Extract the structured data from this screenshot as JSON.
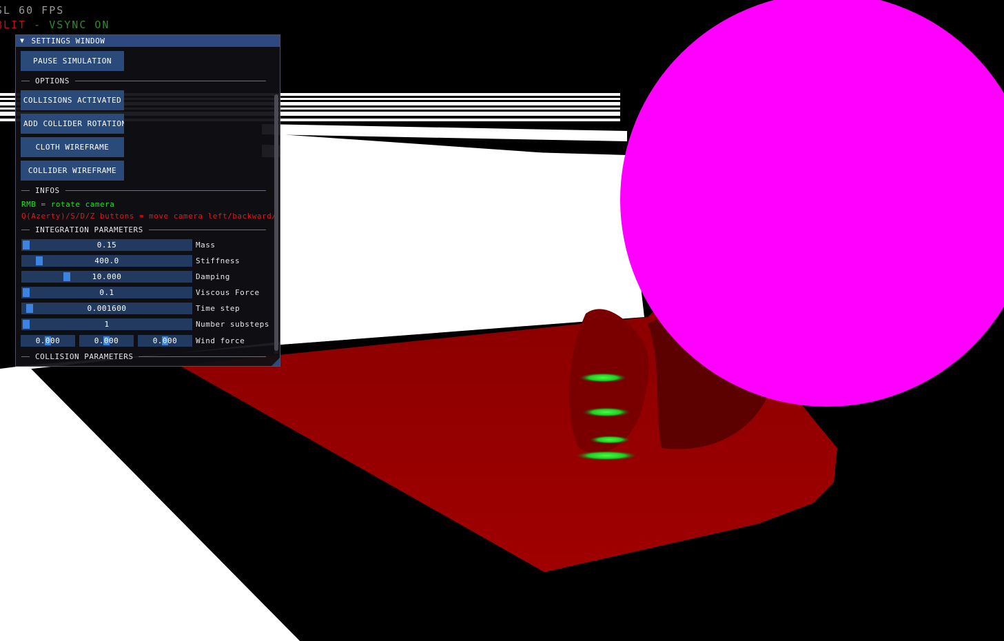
{
  "overlay": {
    "fps": "SL 60 FPS",
    "vsync_prefix": "BLIT",
    "vsync_suffix": " - VSYNC ON"
  },
  "window": {
    "title": "SETTINGS WINDOW",
    "collapse_glyph": "▼",
    "pause_label": "PAUSE SIMULATION",
    "options_header": "OPTIONS",
    "collisions_label": "COLLISIONS ACTIVATED",
    "add_rotation_label": "ADD COLLIDER ROTATION",
    "cloth_wireframe_label": "CLOTH WIREFRAME",
    "collider_wireframe_label": "COLLIDER WIREFRAME",
    "infos_header": "INFOS",
    "info_rmb": "RMB = rotate camera",
    "info_keys": "Q(Azerty)/S/D/Z buttons = move camera left/backward/",
    "integration_header": "INTEGRATION PARAMETERS",
    "collision_header": "COLLISION PARAMETERS",
    "params": [
      {
        "label": "Mass",
        "value": "0.15",
        "fill": 0.0
      },
      {
        "label": "Stiffness",
        "value": "400.0",
        "fill": 0.08
      },
      {
        "label": "Damping",
        "value": "10.000",
        "fill": 0.25
      },
      {
        "label": "Viscous Force",
        "value": "0.1",
        "fill": 0.0
      },
      {
        "label": "Time step",
        "value": "0.001600",
        "fill": 0.02
      },
      {
        "label": "Number substeps",
        "value": "1",
        "fill": 0.0
      }
    ],
    "wind": {
      "label": "Wind force",
      "values": [
        "0.000",
        "0.000",
        "0.000"
      ],
      "fill": 0.5
    }
  },
  "colors": {
    "button": "#2a4a7a",
    "title_bar": "#2c4a80",
    "slider_grab": "#3d84e0",
    "info_green": "#22dd22",
    "info_red": "#e01818",
    "cloth": "#9c0000",
    "sphere": "#ff00ff"
  }
}
